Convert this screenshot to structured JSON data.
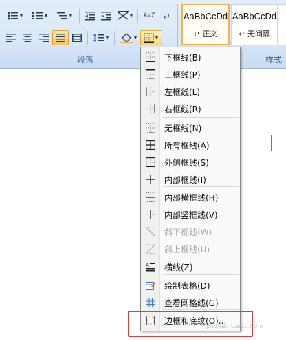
{
  "ribbon": {
    "paragraph_group_label": "段落",
    "styles_group_label": "样式",
    "styles": [
      {
        "sample": "AaBbCcDd",
        "name": "↵ 正文"
      },
      {
        "sample": "AaBbCcDd",
        "name": "↵ 无间隔"
      }
    ],
    "sort_glyph": "A↓Z",
    "marks_glyph": "↵"
  },
  "menu": {
    "items": [
      {
        "label": "下框线(B)",
        "icon": "border-bottom-icon",
        "disabled": false
      },
      {
        "label": "上框线(P)",
        "icon": "border-top-icon",
        "disabled": false
      },
      {
        "label": "左框线(L)",
        "icon": "border-left-icon",
        "disabled": false
      },
      {
        "label": "右框线(R)",
        "icon": "border-right-icon",
        "disabled": false
      },
      {
        "label": "无框线(N)",
        "icon": "border-none-icon",
        "disabled": false
      },
      {
        "label": "所有框线(A)",
        "icon": "border-all-icon",
        "disabled": false
      },
      {
        "label": "外侧框线(S)",
        "icon": "border-outside-icon",
        "disabled": false
      },
      {
        "label": "内部框线(I)",
        "icon": "border-inside-icon",
        "disabled": false
      },
      {
        "label": "内部横框线(H)",
        "icon": "border-inside-horizontal-icon",
        "disabled": false
      },
      {
        "label": "内部竖框线(V)",
        "icon": "border-inside-vertical-icon",
        "disabled": false
      },
      {
        "label": "斜下框线(W)",
        "icon": "diagonal-down-border-icon",
        "disabled": true
      },
      {
        "label": "斜上框线(U)",
        "icon": "diagonal-up-border-icon",
        "disabled": true
      },
      {
        "label": "横线(Z)",
        "icon": "horizontal-line-icon",
        "disabled": false
      },
      {
        "label": "绘制表格(D)",
        "icon": "draw-table-icon",
        "disabled": false
      },
      {
        "label": "查看网格线(G)",
        "icon": "view-gridlines-icon",
        "disabled": false
      },
      {
        "label": "边框和底纹(O)...",
        "icon": "borders-shading-icon",
        "disabled": false
      }
    ]
  },
  "watermark": "jingyan.baidu.com",
  "colors": {
    "highlight_box": "#e03c3c",
    "ribbon_bg": "#dbe8f7"
  }
}
